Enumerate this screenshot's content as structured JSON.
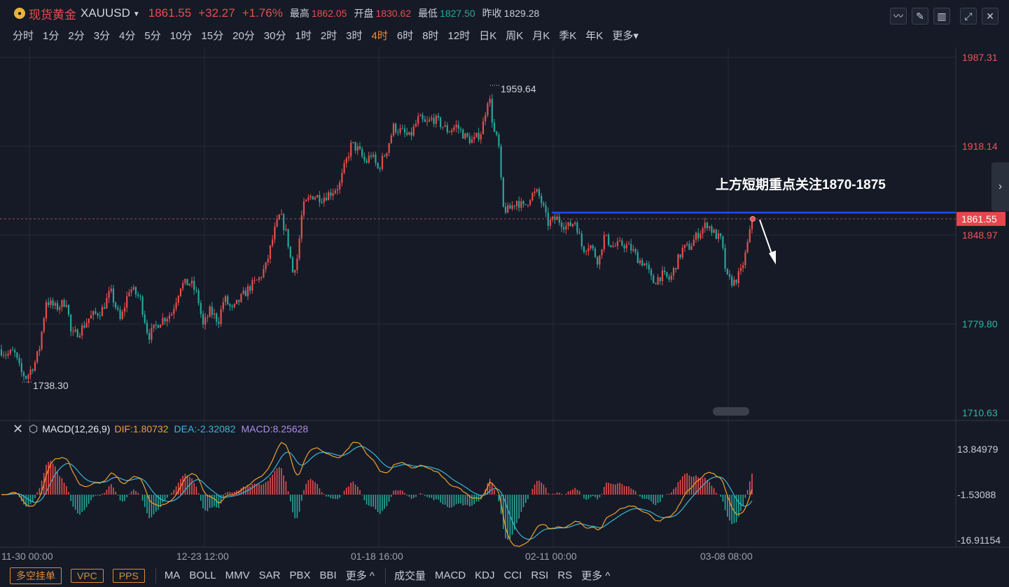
{
  "header": {
    "name": "现货黄金",
    "ticker": "XAUUSD",
    "price": "1861.55",
    "change": "+32.27",
    "change_pct": "+1.76%",
    "high_label": "最高",
    "high": "1862.05",
    "open_label": "开盘",
    "open": "1830.62",
    "low_label": "最低",
    "low": "1827.50",
    "prev_label": "昨收",
    "prev": "1829.28"
  },
  "periods": [
    "分时",
    "1分",
    "2分",
    "3分",
    "4分",
    "5分",
    "10分",
    "15分",
    "20分",
    "30分",
    "1时",
    "2时",
    "3时",
    "4时",
    "6时",
    "8时",
    "12时",
    "日K",
    "周K",
    "月K",
    "季K",
    "年K",
    "更多"
  ],
  "active_period": "4时",
  "colors": {
    "up": "#e84d4d",
    "down": "#26a69a",
    "dif": "#f0a030",
    "dea": "#3ab7d9",
    "macd": "#b18ce6",
    "level_line": "#1f4fe8",
    "accent": "#f08a3a"
  },
  "chart_data": [
    {
      "type": "candlestick",
      "ylim": [
        1710.63,
        1987.31
      ],
      "y_ticks": [
        "1987.31",
        "1918.14",
        "1848.97",
        "1779.80",
        "1710.63"
      ],
      "x_ticks": [
        "11-30 00:00",
        "12-23 12:00",
        "01-18 16:00",
        "02-11 00:00",
        "03-08 08:00"
      ],
      "current_price": "1861.55",
      "max_marker": "1959.64",
      "min_marker": "1738.30",
      "annotation": "上方短期重点关注1870-1875",
      "level_line_value": 1866.5,
      "watermark": "",
      "path": [
        [
          0,
          1760
        ],
        [
          10,
          1756
        ],
        [
          20,
          1758
        ],
        [
          30,
          1742
        ],
        [
          38,
          1738.3
        ],
        [
          50,
          1750
        ],
        [
          56,
          1760
        ],
        [
          66,
          1798
        ],
        [
          80,
          1792
        ],
        [
          95,
          1798
        ],
        [
          102,
          1770
        ],
        [
          115,
          1775
        ],
        [
          128,
          1785
        ],
        [
          145,
          1790
        ],
        [
          158,
          1805
        ],
        [
          172,
          1782
        ],
        [
          185,
          1808
        ],
        [
          200,
          1800
        ],
        [
          212,
          1770
        ],
        [
          228,
          1782
        ],
        [
          245,
          1788
        ],
        [
          258,
          1810
        ],
        [
          272,
          1812
        ],
        [
          282,
          1802
        ],
        [
          290,
          1778
        ],
        [
          300,
          1790
        ],
        [
          312,
          1782
        ],
        [
          320,
          1800
        ],
        [
          332,
          1790
        ],
        [
          340,
          1797
        ],
        [
          356,
          1808
        ],
        [
          370,
          1815
        ],
        [
          380,
          1825
        ],
        [
          392,
          1852
        ],
        [
          400,
          1865
        ],
        [
          410,
          1848
        ],
        [
          418,
          1820
        ],
        [
          425,
          1832
        ],
        [
          432,
          1870
        ],
        [
          445,
          1880
        ],
        [
          460,
          1878
        ],
        [
          472,
          1882
        ],
        [
          485,
          1888
        ],
        [
          492,
          1902
        ],
        [
          502,
          1920
        ],
        [
          512,
          1915
        ],
        [
          522,
          1905
        ],
        [
          530,
          1912
        ],
        [
          540,
          1900
        ],
        [
          552,
          1915
        ],
        [
          562,
          1933
        ],
        [
          572,
          1930
        ],
        [
          585,
          1925
        ],
        [
          598,
          1940
        ],
        [
          608,
          1935
        ],
        [
          618,
          1940
        ],
        [
          628,
          1936
        ],
        [
          640,
          1930
        ],
        [
          652,
          1934
        ],
        [
          665,
          1925
        ],
        [
          676,
          1922
        ],
        [
          688,
          1930
        ],
        [
          698,
          1959.64
        ],
        [
          705,
          1930
        ],
        [
          712,
          1920
        ],
        [
          718,
          1870
        ],
        [
          726,
          1868
        ],
        [
          738,
          1876
        ],
        [
          748,
          1870
        ],
        [
          758,
          1880
        ],
        [
          768,
          1882
        ],
        [
          775,
          1872
        ],
        [
          782,
          1858
        ],
        [
          795,
          1862
        ],
        [
          810,
          1855
        ],
        [
          822,
          1860
        ],
        [
          832,
          1838
        ],
        [
          842,
          1842
        ],
        [
          855,
          1828
        ],
        [
          862,
          1848
        ],
        [
          876,
          1840
        ],
        [
          890,
          1842
        ],
        [
          902,
          1838
        ],
        [
          912,
          1830
        ],
        [
          922,
          1826
        ],
        [
          932,
          1812
        ],
        [
          945,
          1818
        ],
        [
          957,
          1814
        ],
        [
          965,
          1826
        ],
        [
          975,
          1838
        ],
        [
          985,
          1840
        ],
        [
          997,
          1850
        ],
        [
          1010,
          1858
        ],
        [
          1020,
          1850
        ],
        [
          1030,
          1845
        ],
        [
          1038,
          1815
        ],
        [
          1048,
          1812
        ],
        [
          1058,
          1820
        ],
        [
          1065,
          1835
        ],
        [
          1075,
          1861.55
        ]
      ]
    },
    {
      "type": "macd",
      "params": "MACD(12,26,9)",
      "dif_label": "DIF:1.80732",
      "dea_label": "DEA:-2.32082",
      "macd_label": "MACD:8.25628",
      "ylim": [
        -16.91154,
        13.84979
      ],
      "y_ticks": [
        "13.84979",
        "-1.53088",
        "-16.91154"
      ]
    }
  ],
  "bottom": {
    "order_buttons": [
      "多空挂单",
      "VPC",
      "PPS"
    ],
    "main_indicators": [
      "MA",
      "BOLL",
      "MMV",
      "SAR",
      "PBX",
      "BBI",
      "更多 ^"
    ],
    "sub_indicators": [
      "成交量",
      "MACD",
      "KDJ",
      "CCI",
      "RSI",
      "RS",
      "更多 ^"
    ]
  }
}
